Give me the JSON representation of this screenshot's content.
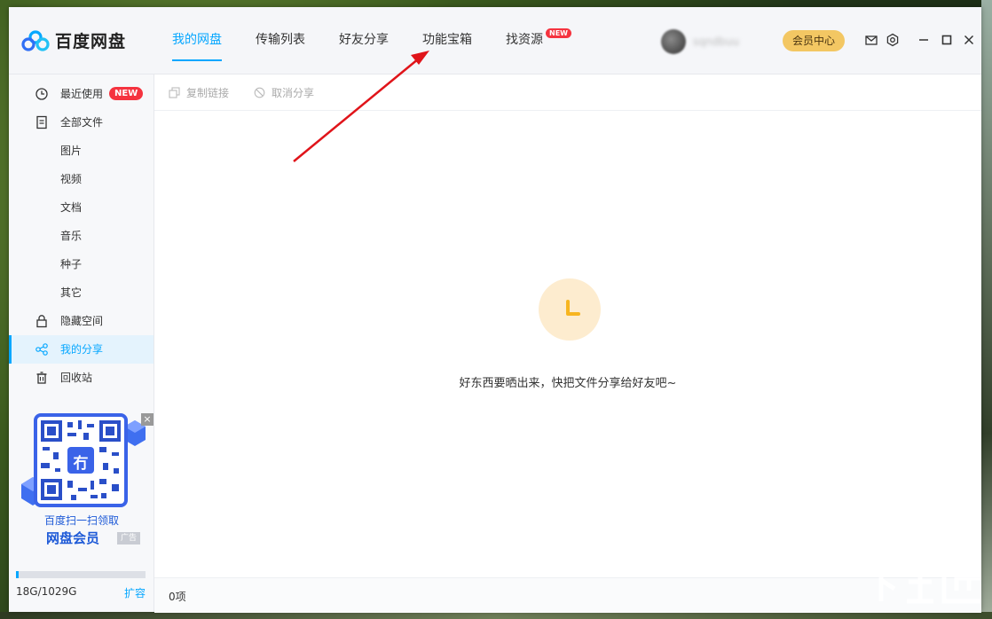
{
  "app": {
    "name": "百度网盘"
  },
  "nav": {
    "tabs": [
      {
        "label": "我的网盘"
      },
      {
        "label": "传输列表"
      },
      {
        "label": "好友分享"
      },
      {
        "label": "功能宝箱"
      },
      {
        "label": "找资源",
        "badge": "NEW"
      }
    ]
  },
  "user": {
    "name": "sqndbuu",
    "vip_button": "会员中心"
  },
  "sidebar": {
    "items": [
      {
        "label": "最近使用",
        "icon": "clock-icon",
        "badge": "NEW"
      },
      {
        "label": "全部文件",
        "icon": "file-icon"
      },
      {
        "label": "图片"
      },
      {
        "label": "视频"
      },
      {
        "label": "文档"
      },
      {
        "label": "音乐"
      },
      {
        "label": "种子"
      },
      {
        "label": "其它"
      },
      {
        "label": "隐藏空间",
        "icon": "lock-icon"
      },
      {
        "label": "我的分享",
        "icon": "share-icon"
      },
      {
        "label": "回收站",
        "icon": "trash-icon"
      }
    ],
    "ad": {
      "close": "×",
      "line1": "百度扫一扫领取",
      "line2": "网盘会员",
      "tag": "广告",
      "qr_center": "冇"
    },
    "storage": {
      "text": "18G/1029G",
      "used_fraction": 0.017,
      "expand": "扩容"
    }
  },
  "toolbar": {
    "copy_link": "复制链接",
    "cancel_share": "取消分享"
  },
  "main": {
    "empty_message": "好东西要晒出来，快把文件分享给好友吧~"
  },
  "footer": {
    "count": "0项"
  },
  "colors": {
    "accent": "#06a7ff",
    "badge": "#f5333f",
    "vip": "#f3c763",
    "arrow": "#e0141a"
  }
}
